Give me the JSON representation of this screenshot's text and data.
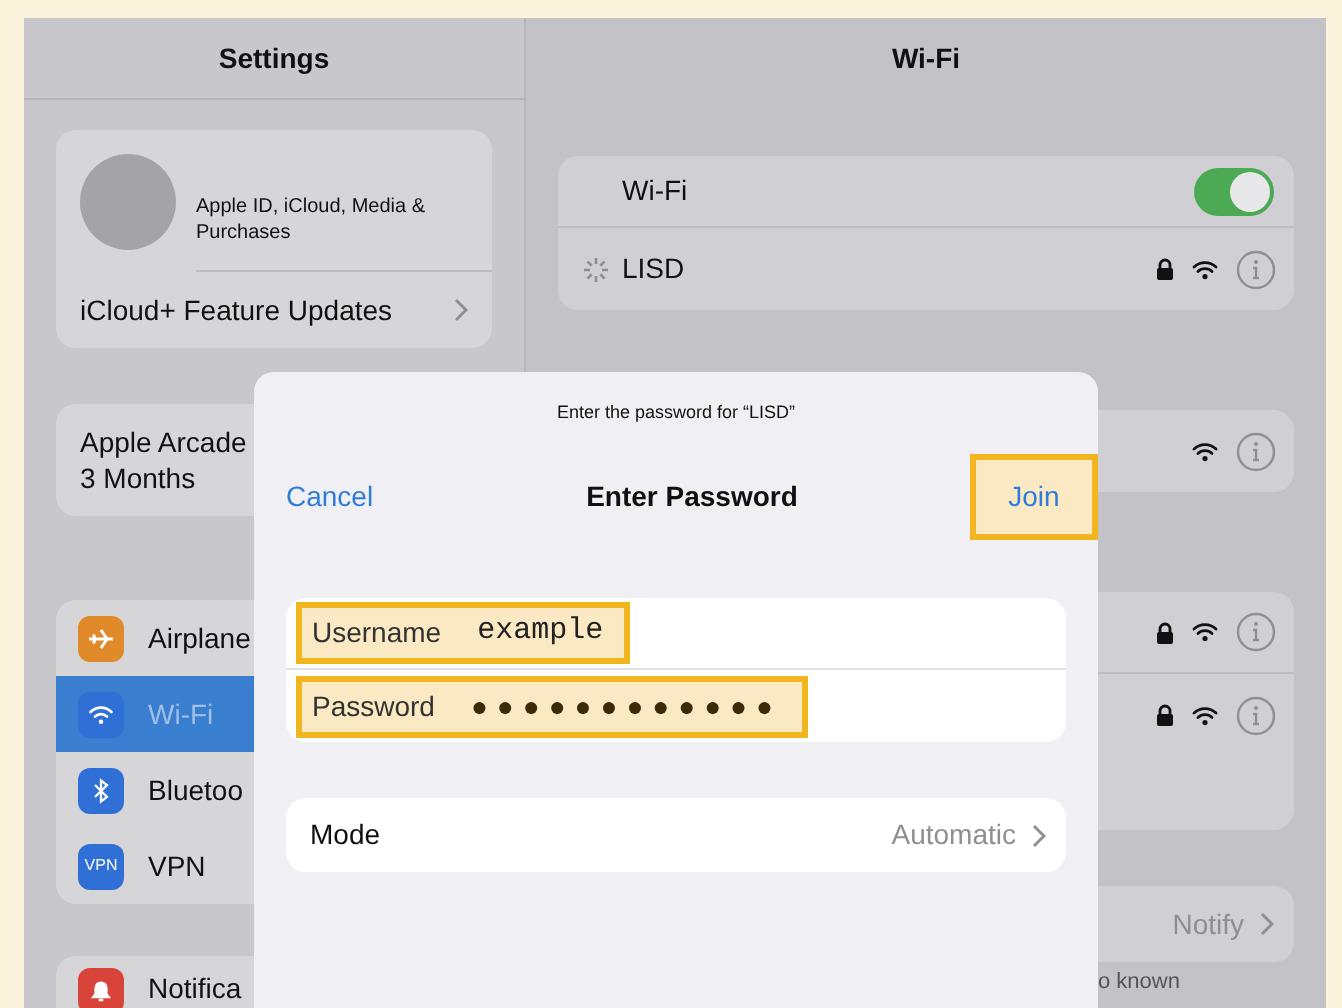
{
  "sidebar": {
    "title": "Settings",
    "profile": {
      "subtitle": "Apple ID, iCloud, Media & Purchases",
      "row": "iCloud+ Feature Updates"
    },
    "arcade": {
      "line1": "Apple Arcade",
      "line2": "3 Months"
    },
    "items": [
      {
        "label": "Airplane",
        "kind": "airplane",
        "selected": false
      },
      {
        "label": "Wi-Fi",
        "kind": "wifi",
        "selected": true
      },
      {
        "label": "Bluetoo",
        "kind": "bluetooth",
        "selected": false
      },
      {
        "label": "VPN",
        "kind": "vpn",
        "icon_text": "VPN",
        "selected": false
      }
    ],
    "next_item": {
      "label": "Notifica",
      "kind": "bell"
    }
  },
  "detail": {
    "title": "Wi-Fi",
    "wifi_row": {
      "label": "Wi-Fi",
      "on": true
    },
    "network": {
      "name": "LISD",
      "connecting": true,
      "locked": true
    },
    "group_1": [
      {
        "locked": false
      }
    ],
    "group_2": [
      {
        "locked": true
      },
      {
        "locked": true
      },
      {
        "kind": "empty"
      }
    ],
    "notify": "Notify",
    "footer": "o known"
  },
  "dialog": {
    "prompt": "Enter the password for “LISD”",
    "cancel": "Cancel",
    "title": "Enter Password",
    "join": {
      "label": "Join",
      "highlighted": true
    },
    "fields": [
      {
        "kind": "text",
        "label": "Username",
        "value": "example",
        "highlighted": true
      },
      {
        "kind": "password",
        "label": "Password",
        "value": "●●●●●●●●●●●●",
        "highlighted": true
      }
    ],
    "mode": {
      "label": "Mode",
      "value": "Automatic"
    }
  }
}
